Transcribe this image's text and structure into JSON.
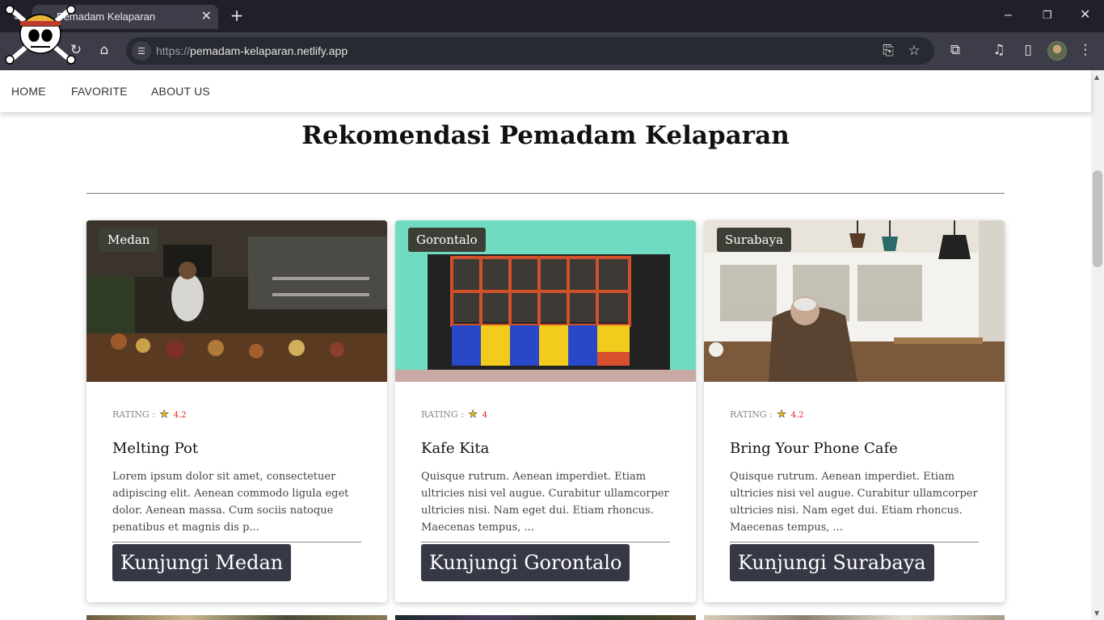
{
  "browser": {
    "tab_title": "Pemadam Kelaparan",
    "url_scheme": "https://",
    "url_host": "pemadam-kelaparan.netlify.app"
  },
  "nav": {
    "items": [
      {
        "label": "HOME"
      },
      {
        "label": "FAVORITE"
      },
      {
        "label": "ABOUT US"
      }
    ]
  },
  "main": {
    "title": "Rekomendasi Pemadam Kelaparan",
    "rating_label": "RATING :",
    "cards": [
      {
        "city": "Medan",
        "rating": "4.2",
        "name": "Melting Pot",
        "description": "Lorem ipsum dolor sit amet, consectetuer adipiscing elit. Aenean commodo ligula eget dolor. Aenean massa. Cum sociis natoque penatibus et magnis dis p...",
        "button": "Kunjungi Medan"
      },
      {
        "city": "Gorontalo",
        "rating": "4",
        "name": "Kafe Kita",
        "description": "Quisque rutrum. Aenean imperdiet. Etiam ultricies nisi vel augue. Curabitur ullamcorper ultricies nisi. Nam eget dui. Etiam rhoncus. Maecenas tempus, ...",
        "button": "Kunjungi Gorontalo"
      },
      {
        "city": "Surabaya",
        "rating": "4.2",
        "name": "Bring Your Phone Cafe",
        "description": "Quisque rutrum. Aenean imperdiet. Etiam ultricies nisi vel augue. Curabitur ullamcorper ultricies nisi. Nam eget dui. Etiam rhoncus. Maecenas tempus, ...",
        "button": "Kunjungi Surabaya"
      }
    ]
  },
  "colors": {
    "chrome_dark": "#1f2029",
    "chrome_toolbar": "#3c3d48",
    "badge_bg": "#3d3f36",
    "button_bg": "#363845",
    "rating_value": "#ee2222"
  },
  "icons": [
    "tab-list-icon",
    "close-icon",
    "plus-icon",
    "minimize-icon",
    "restore-icon",
    "reload-icon",
    "home-icon",
    "site-info-icon",
    "install-app-icon",
    "star-icon",
    "extensions-icon",
    "media-icon",
    "sidepanel-icon",
    "menu-dots-icon",
    "rating-star-icon",
    "skull-logo"
  ]
}
